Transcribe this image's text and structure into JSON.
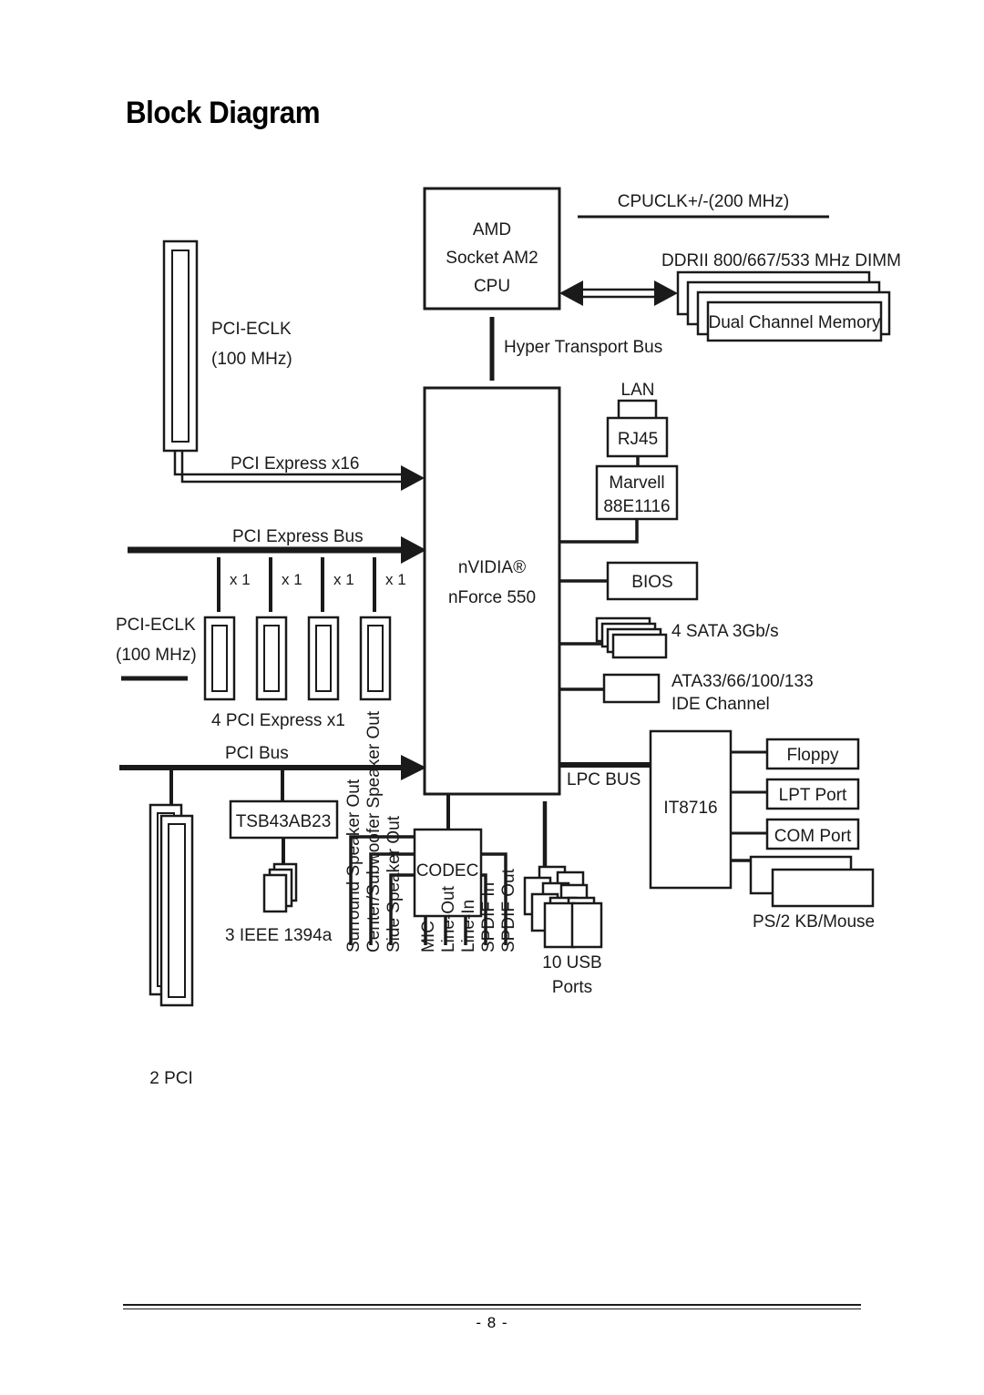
{
  "page": {
    "title": "Block Diagram",
    "page_number": "- 8 -"
  },
  "diagram": {
    "type": "block-diagram",
    "blocks": {
      "cpu": {
        "lines": [
          "AMD",
          "Socket AM2",
          "CPU"
        ]
      },
      "chipset": {
        "lines": [
          "nVIDIA®",
          "nForce 550"
        ]
      },
      "rj45": {
        "label": "RJ45"
      },
      "phy": {
        "lines": [
          "Marvell",
          "88E1116"
        ]
      },
      "bios": {
        "label": "BIOS"
      },
      "superio": {
        "label": "IT8716"
      },
      "codec": {
        "label": "CODEC"
      },
      "firewire_chip": {
        "label": "TSB43AB23"
      },
      "memory": {
        "label": "Dual Channel Memory"
      },
      "floppy": {
        "label": "Floppy"
      },
      "lpt": {
        "label": "LPT Port"
      },
      "com": {
        "label": "COM Port"
      }
    },
    "labels": {
      "cpuclk": "CPUCLK+/-(200 MHz)",
      "dimm": "DDRII 800/667/533 MHz DIMM",
      "hypertransport": "Hyper Transport Bus",
      "pci_eclk_top": "PCI-ECLK",
      "pci_eclk_top_freq": "(100 MHz)",
      "pcie_x16": "PCI Express x16",
      "pcie_bus": "PCI Express Bus",
      "pci_eclk_bottom": "PCI-ECLK",
      "pci_eclk_bottom_freq": "(100 MHz)",
      "pcie_x1_count": "4 PCI Express x1",
      "pci_bus": "PCI Bus",
      "lan": "LAN",
      "sata": "4 SATA 3Gb/s",
      "ide_line1": "ATA33/66/100/133",
      "ide_line2": "IDE Channel",
      "lpc_bus": "LPC BUS",
      "ps2": "PS/2 KB/Mouse",
      "usb_line1": "10 USB",
      "usb_line2": "Ports",
      "ieee1394": "3 IEEE 1394a",
      "pci_slots": "2 PCI",
      "lane_x1": [
        "x 1",
        "x 1",
        "x 1",
        "x 1"
      ]
    },
    "audio_ports": [
      "Surround Speaker Out",
      "Center/Subwoofer Speaker Out",
      "Side Speaker Out",
      "MIC",
      "Line-Out",
      "Line-In",
      "SPDIF In",
      "SPDIF Out"
    ],
    "colors": {
      "ink": "#1a1a1a",
      "paper": "#ffffff"
    }
  }
}
